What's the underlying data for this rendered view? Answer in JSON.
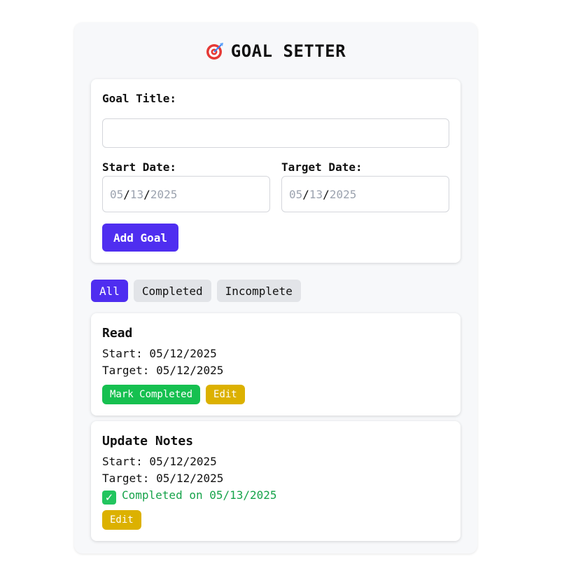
{
  "header": {
    "icon": "target-icon",
    "title": "GOAL SETTER"
  },
  "form": {
    "goal_title_label": "Goal Title:",
    "goal_title_value": "",
    "start_date_label": "Start Date:",
    "start_date": {
      "month": "05",
      "day": "13",
      "year": "2025"
    },
    "target_date_label": "Target Date:",
    "target_date": {
      "month": "05",
      "day": "13",
      "year": "2025"
    },
    "date_separator": "/",
    "add_button": "Add Goal"
  },
  "filters": {
    "all": "All",
    "completed": "Completed",
    "incomplete": "Incomplete",
    "active": "All"
  },
  "goals": [
    {
      "title": "Read",
      "start": "Start: 05/12/2025",
      "target": "Target: 05/12/2025",
      "completed": false,
      "mark_button": "Mark Completed",
      "edit_button": "Edit"
    },
    {
      "title": "Update Notes",
      "start": "Start: 05/12/2025",
      "target": "Target: 05/12/2025",
      "completed": true,
      "completed_text": "Completed on 05/13/2025",
      "completed_icon": "check-mark-icon",
      "edit_button": "Edit"
    }
  ],
  "colors": {
    "accent": "#4f2ef0",
    "success": "#16c050",
    "warning": "#dcb100",
    "completed_text": "#16a34a"
  }
}
